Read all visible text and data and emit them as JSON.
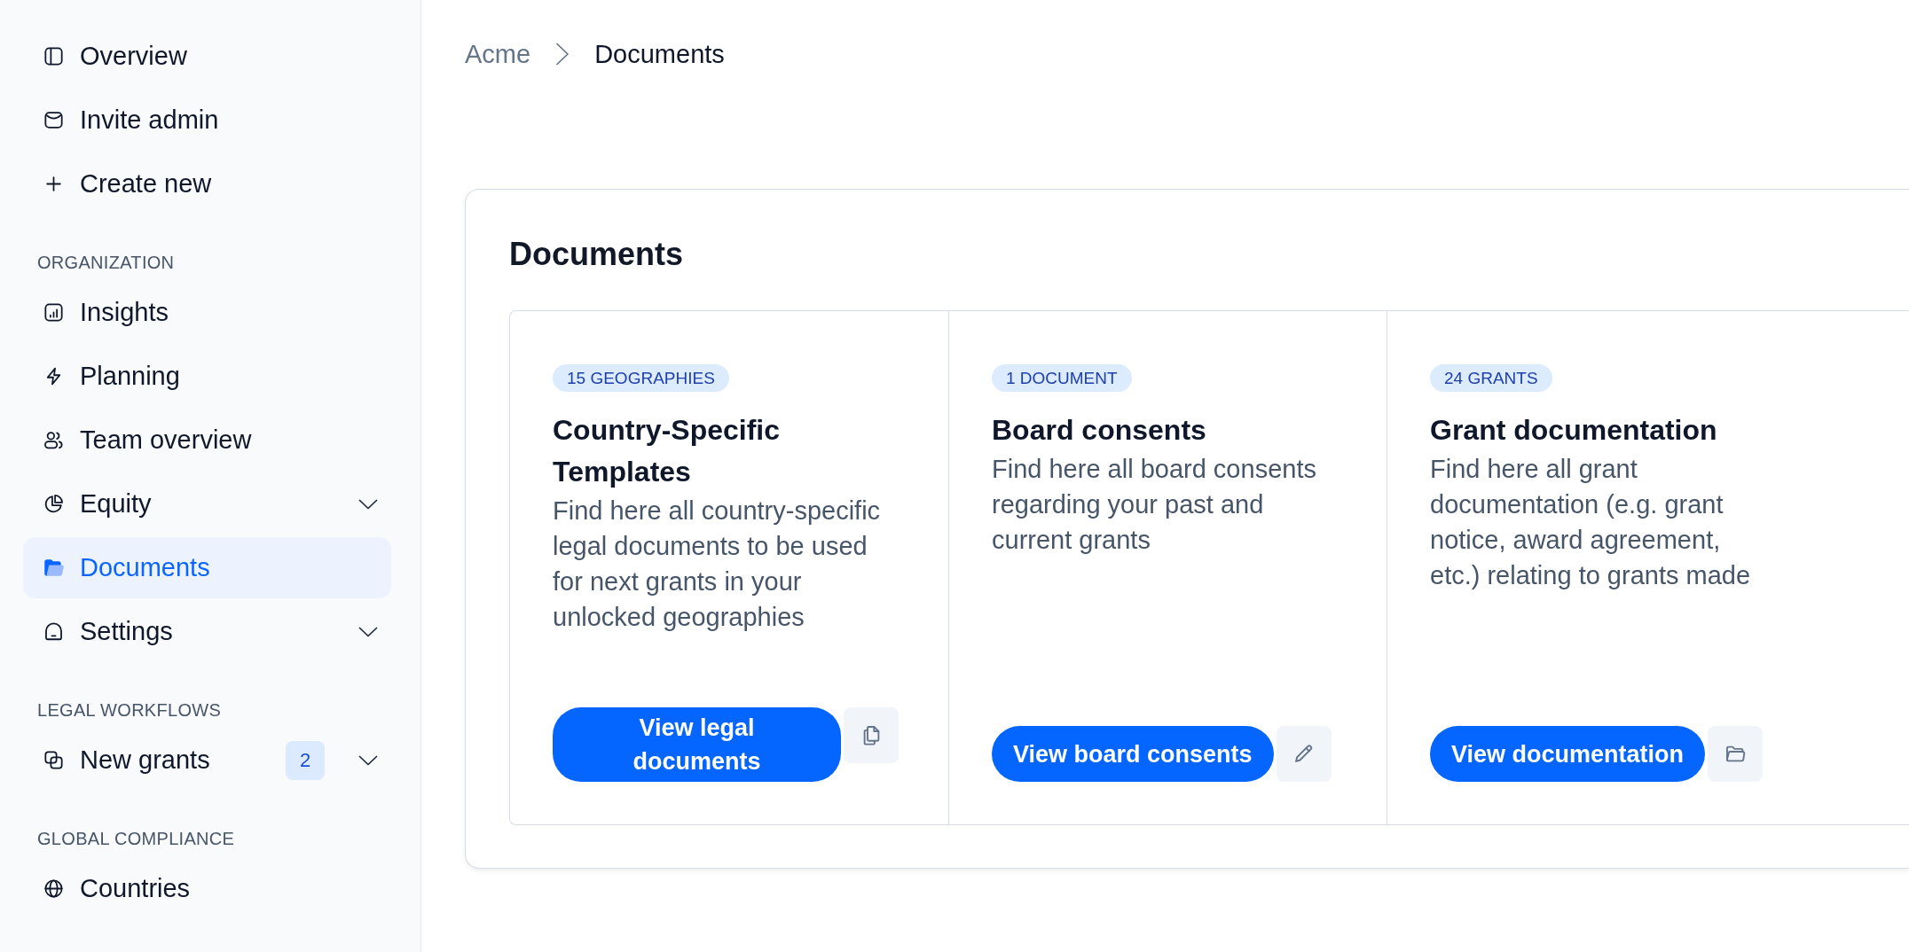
{
  "sidebar": {
    "groups": [
      {
        "items": [
          {
            "label": "Overview",
            "kind": "link",
            "selected": false
          },
          {
            "label": "Invite admin",
            "kind": "link",
            "selected": false
          },
          {
            "label": "Create new",
            "kind": "link",
            "selected": false
          }
        ]
      },
      {
        "heading": "ORGANIZATION",
        "items": [
          {
            "label": "Insights",
            "kind": "link",
            "selected": false
          },
          {
            "label": "Planning",
            "kind": "link",
            "selected": false
          },
          {
            "label": "Team overview",
            "kind": "link",
            "selected": false
          },
          {
            "label": "Equity",
            "kind": "group",
            "expanded": false,
            "selected": false
          },
          {
            "label": "Documents",
            "kind": "link",
            "selected": true
          },
          {
            "label": "Settings",
            "kind": "group",
            "expanded": false,
            "selected": false
          }
        ]
      },
      {
        "heading": "LEGAL WORKFLOWS",
        "items": [
          {
            "label": "New grants",
            "kind": "group",
            "badge": "2",
            "expanded": false,
            "selected": false
          }
        ]
      },
      {
        "heading": "GLOBAL COMPLIANCE",
        "items": [
          {
            "label": "Countries",
            "kind": "link",
            "selected": false
          }
        ]
      }
    ]
  },
  "breadcrumb": [
    {
      "label": "Acme",
      "current": false
    },
    {
      "label": "Documents",
      "current": true
    }
  ],
  "documents_card": {
    "title": "Documents",
    "categories": [
      {
        "badge": "15 GEOGRAPHIES",
        "title": "Country-Specific Templates",
        "description": "Find here all country-specific legal documents to be used for next grants in your unlocked geographies",
        "button": "View legal documents"
      },
      {
        "badge": "1 DOCUMENT",
        "title": "Board consents",
        "description": "Find here all board consents regarding your past and current grants",
        "button": "View board consents"
      },
      {
        "badge": "24 GRANTS",
        "title": "Grant documentation",
        "description": "Find here all grant documentation (e.g. grant notice, award agreement, etc.) relating to grants made",
        "button": "View documentation"
      }
    ]
  }
}
